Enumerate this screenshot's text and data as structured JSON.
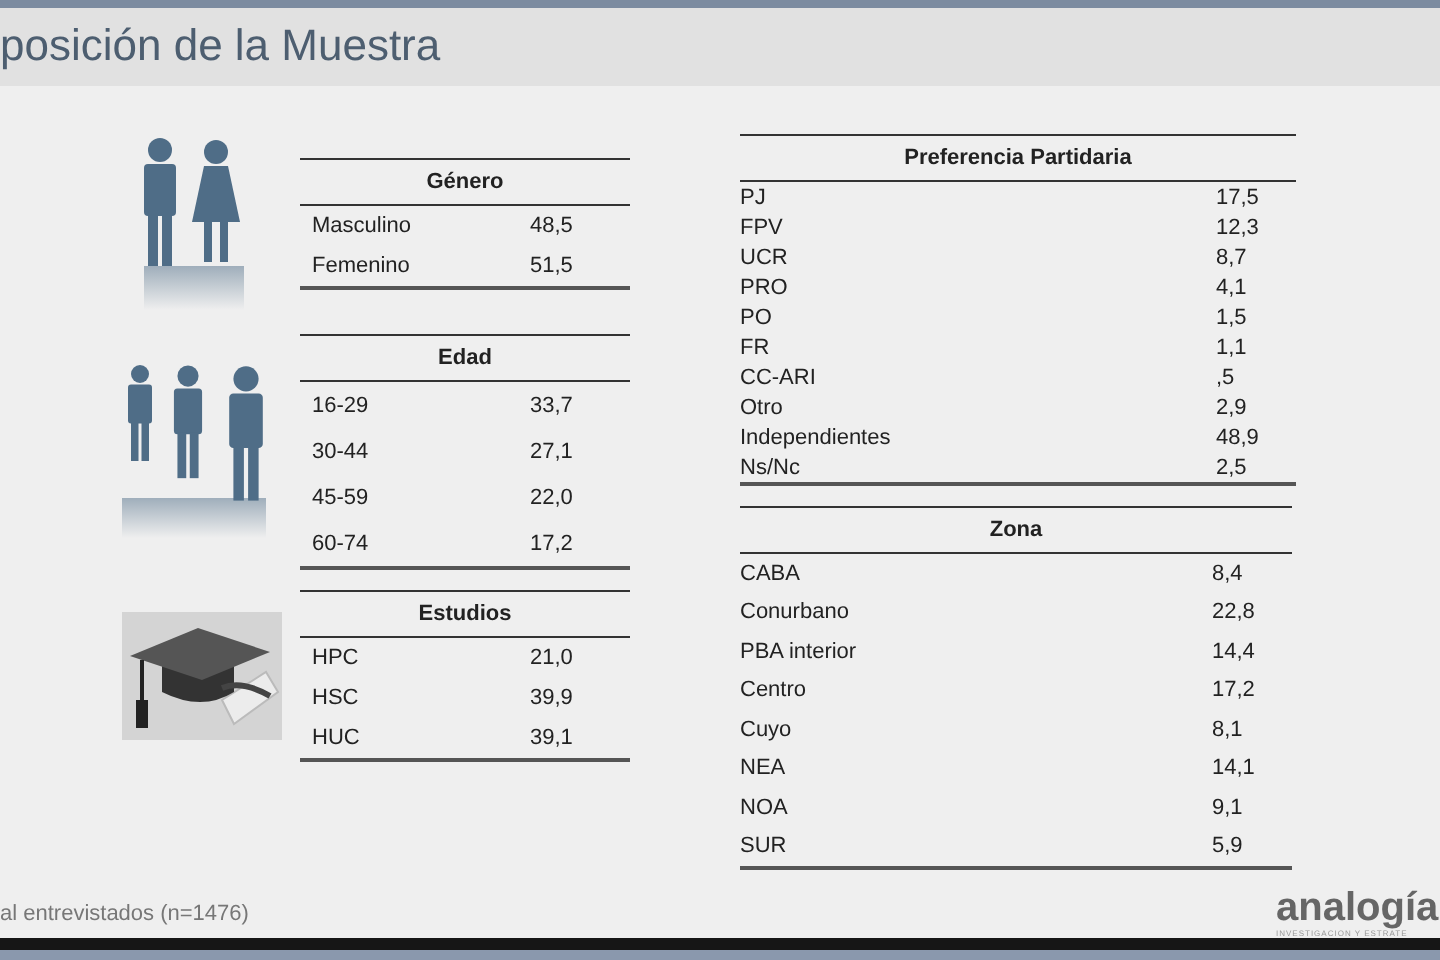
{
  "title": "posición de la Muestra",
  "left_tables": [
    {
      "heading": "Género",
      "rows": [
        {
          "label": "Masculino",
          "value": "48,5"
        },
        {
          "label": "Femenino",
          "value": "51,5"
        }
      ]
    },
    {
      "heading": "Edad",
      "rows": [
        {
          "label": "16-29",
          "value": "33,7"
        },
        {
          "label": "30-44",
          "value": "27,1"
        },
        {
          "label": "45-59",
          "value": "22,0"
        },
        {
          "label": "60-74",
          "value": "17,2"
        }
      ]
    },
    {
      "heading": "Estudios",
      "rows": [
        {
          "label": "HPC",
          "value": "21,0"
        },
        {
          "label": "HSC",
          "value": "39,9"
        },
        {
          "label": "HUC",
          "value": "39,1"
        }
      ]
    }
  ],
  "right_tables": [
    {
      "heading": "Preferencia Partidaria",
      "rows": [
        {
          "label": "PJ",
          "value": "17,5"
        },
        {
          "label": "FPV",
          "value": "12,3"
        },
        {
          "label": "UCR",
          "value": "8,7"
        },
        {
          "label": "PRO",
          "value": "4,1"
        },
        {
          "label": "PO",
          "value": "1,5"
        },
        {
          "label": "FR",
          "value": "1,1"
        },
        {
          "label": "CC-ARI",
          "value": ",5"
        },
        {
          "label": "Otro",
          "value": "2,9"
        },
        {
          "label": "Independientes",
          "value": "48,9"
        },
        {
          "label": "Ns/Nc",
          "value": "2,5"
        }
      ]
    },
    {
      "heading": "Zona",
      "rows": [
        {
          "label": "CABA",
          "value": "8,4"
        },
        {
          "label": "Conurbano",
          "value": "22,8"
        },
        {
          "label": "PBA interior",
          "value": "14,4"
        },
        {
          "label": "Centro",
          "value": "17,2"
        },
        {
          "label": "Cuyo",
          "value": "8,1"
        },
        {
          "label": "NEA",
          "value": "14,1"
        },
        {
          "label": "NOA",
          "value": "9,1"
        },
        {
          "label": "SUR",
          "value": "5,9"
        }
      ]
    }
  ],
  "footer": "al entrevistados (n=1476)",
  "logo": {
    "name": "analogía",
    "tagline": "INVESTIGACION Y ESTRATE"
  }
}
